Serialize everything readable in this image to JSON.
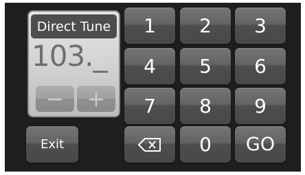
{
  "direct_tune": {
    "title": "Direct Tune",
    "frequency_entry": "103._",
    "minus_label": "−",
    "plus_label": "+"
  },
  "keypad": {
    "keys": [
      "1",
      "2",
      "3",
      "4",
      "5",
      "6",
      "7",
      "8",
      "9"
    ],
    "zero": "0",
    "backspace_icon": "backspace-icon",
    "go_label": "GO"
  },
  "exit_label": "Exit",
  "colors": {
    "screen_background": "#1e1e1e",
    "key_face": "#636363",
    "panel_face": "#d6d6d6",
    "title_bar": "#4d4d4d"
  }
}
